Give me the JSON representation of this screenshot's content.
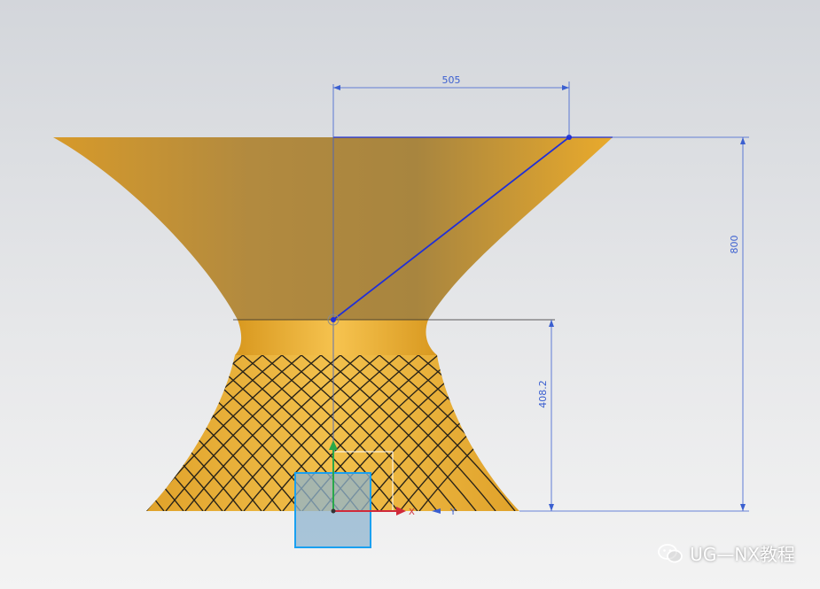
{
  "dimensions": {
    "top_radius": "505",
    "total_height": "800",
    "neck_height": "408.2"
  },
  "triad_labels": {
    "x": "X",
    "y": "Y"
  },
  "watermark": {
    "text": "UG—NX教程",
    "icon": "wechat-icon"
  },
  "colors": {
    "surface": "#e0a22a",
    "surface_light": "#f2bf48",
    "dimension": "#3b5fd0",
    "edge": "#1f2fd8"
  }
}
